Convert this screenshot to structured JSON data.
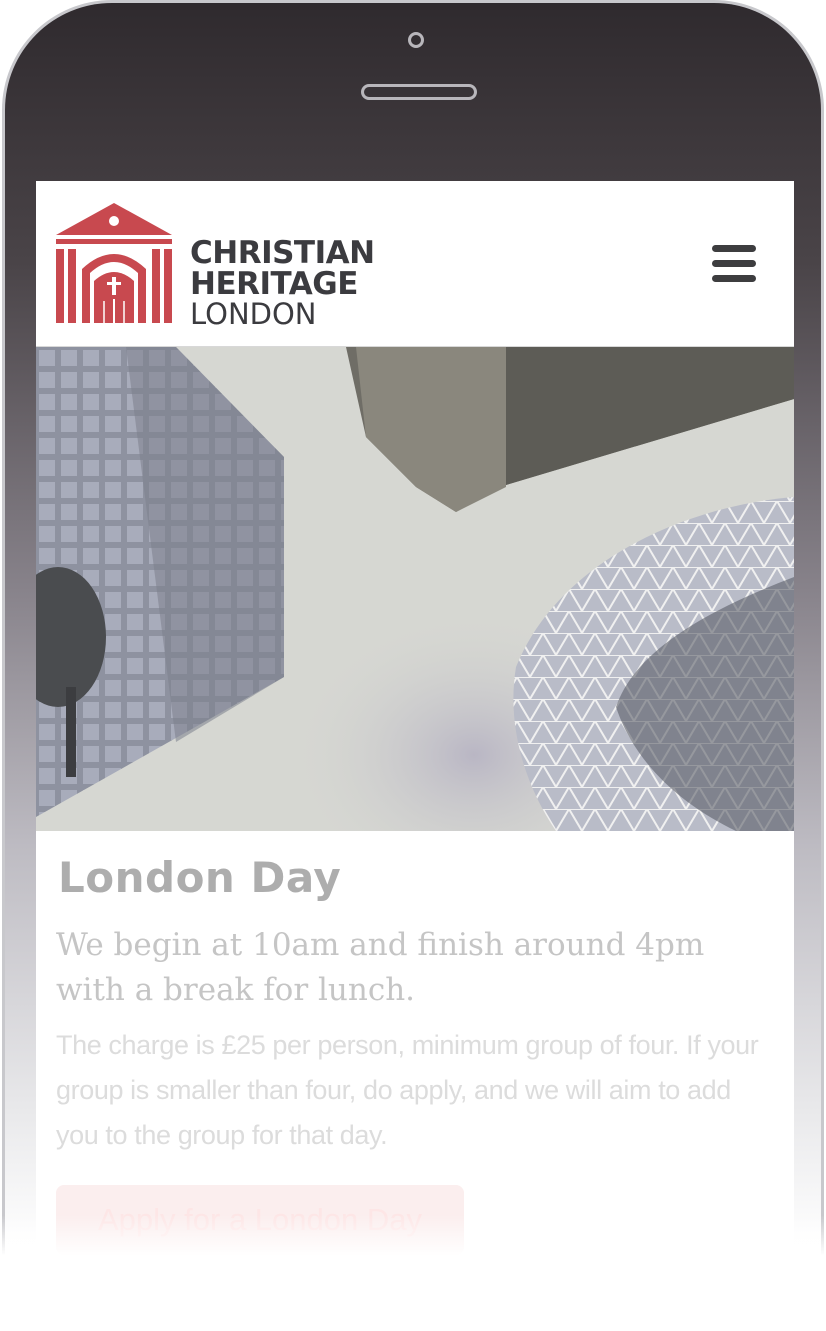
{
  "header": {
    "logo": {
      "line1": "CHRISTIAN",
      "line2": "HERITAGE",
      "line3": "LONDON",
      "icon": "church-facade-icon",
      "accent": "#c8494f"
    },
    "menu_icon": "hamburger-menu-icon"
  },
  "hero": {
    "image": "city-skyscrapers-looking-up-photo"
  },
  "content": {
    "title": "London Day",
    "lead": "We begin at 10am and finish around 4pm with a break for lunch.",
    "body": "The charge is £25 per person, minimum group of four. If your group is smaller than four, do apply, and we will aim to add you to the group for that day.",
    "apply_label": "Apply for a London Day"
  },
  "colors": {
    "brand_red": "#c8494f",
    "text_dark": "#3b3b3f"
  }
}
